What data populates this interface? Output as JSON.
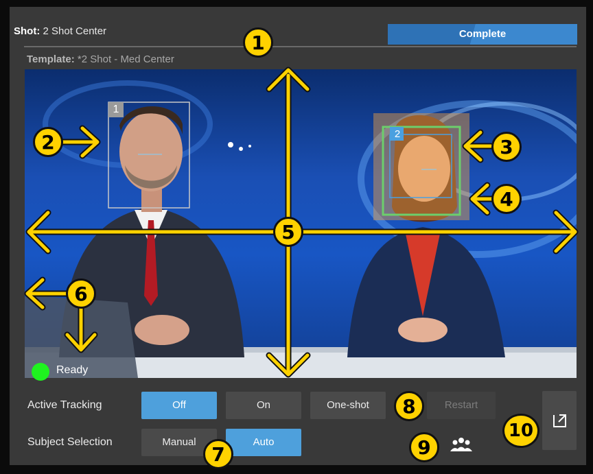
{
  "header": {
    "shot_key": "Shot:",
    "shot_value": "2 Shot Center",
    "status": "Complete",
    "template_key": "Template:",
    "template_value": "*2 Shot - Med Center"
  },
  "video": {
    "faces": [
      {
        "number": "1"
      },
      {
        "number": "2"
      }
    ],
    "status_text": "Ready"
  },
  "controls": {
    "active_tracking_label": "Active Tracking",
    "tracking_off": "Off",
    "tracking_on": "On",
    "tracking_oneshot": "One-shot",
    "tracking_restart": "Restart",
    "tracking_selected": "Off",
    "subject_selection_label": "Subject Selection",
    "subject_manual": "Manual",
    "subject_auto": "Auto",
    "subject_selected": "Auto"
  },
  "callouts": [
    "1",
    "2",
    "3",
    "4",
    "5",
    "6",
    "7",
    "8",
    "9",
    "10"
  ],
  "colors": {
    "accent": "#4ea0dc",
    "status_bar": "#2e72b6",
    "ready": "#1ff21f",
    "callout": "#ffd200",
    "face1_box": "#c8c8c8",
    "face2_box": "#4aa0e0",
    "face2_target": "#f0a040"
  },
  "icons": {
    "people": "people-group-icon",
    "external": "external-link-icon"
  }
}
